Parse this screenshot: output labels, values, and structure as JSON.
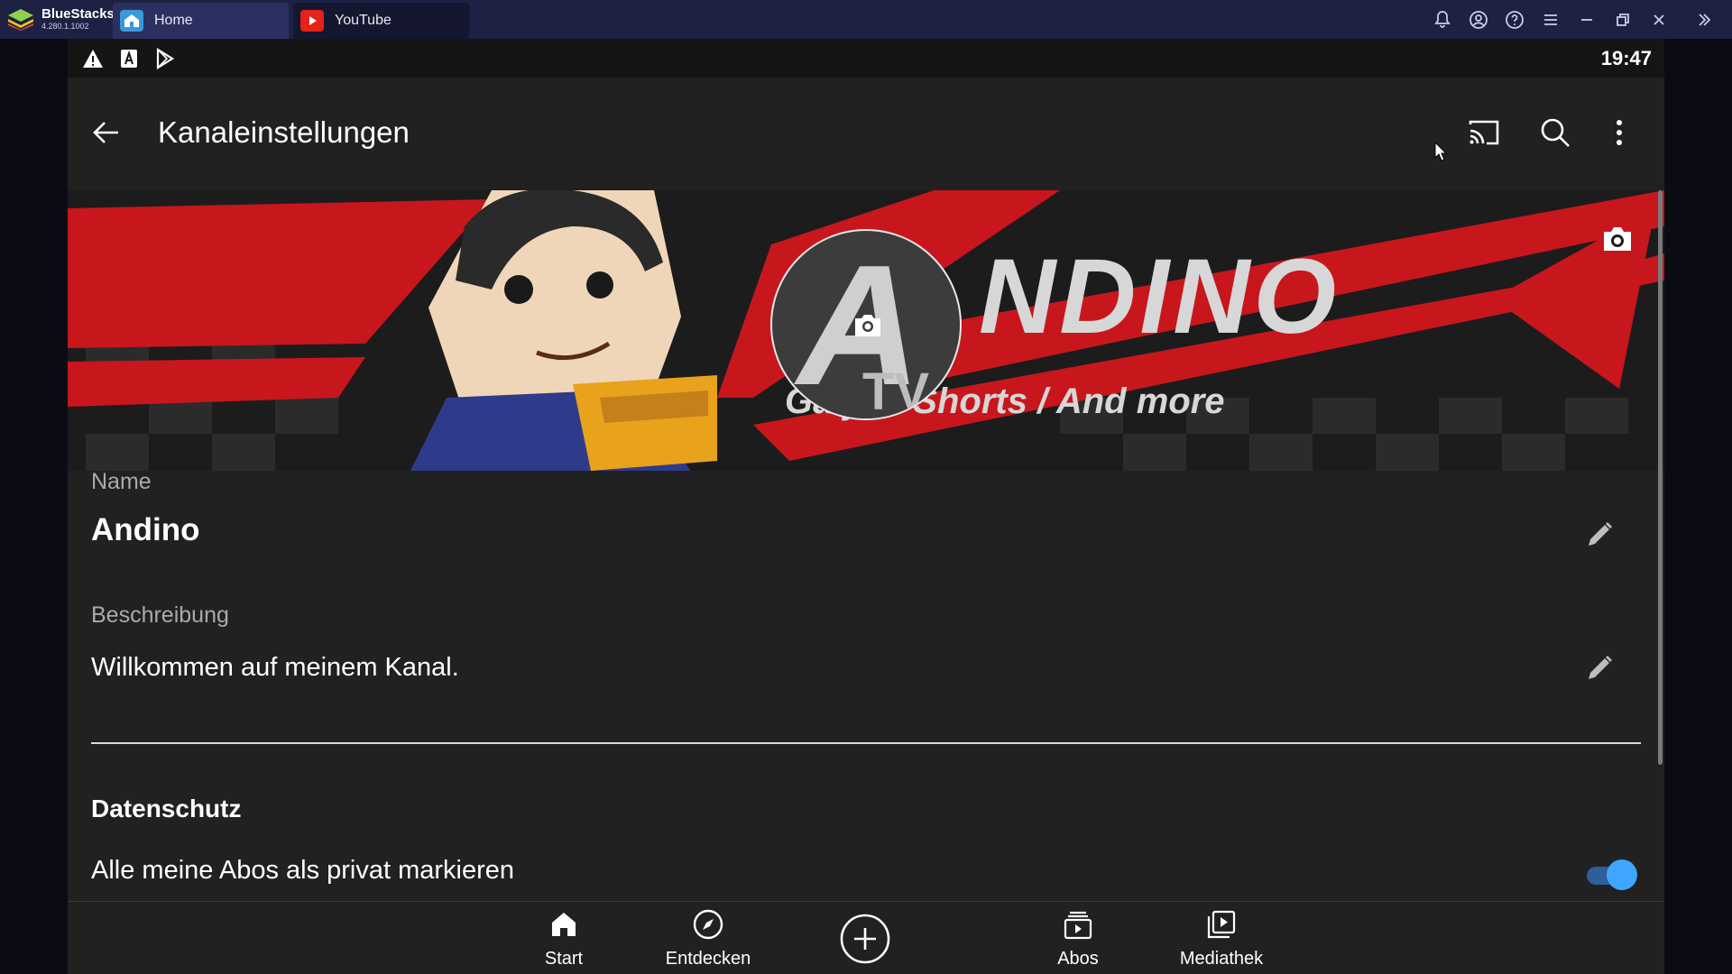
{
  "window": {
    "app_name": "BlueStacks",
    "version": "4.280.1.1002",
    "tabs": [
      {
        "label": "Home",
        "icon": "home-tab-icon",
        "color": "#3a9ad9"
      },
      {
        "label": "YouTube",
        "icon": "youtube-tab-icon",
        "color": "#e62117"
      }
    ],
    "controls": [
      "bell-icon",
      "account-icon",
      "help-icon",
      "menu-icon",
      "minimize-icon",
      "restore-icon",
      "close-icon",
      "expand-sidebar-icon"
    ]
  },
  "status_bar": {
    "time": "19:47",
    "icons": [
      "warning-icon",
      "font-icon",
      "play-store-icon"
    ]
  },
  "app_bar": {
    "title": "Kanaleinstellungen",
    "actions": [
      "cast-icon",
      "search-icon",
      "more-vert-icon"
    ]
  },
  "banner": {
    "title": "NDINO",
    "subtitle": "Ga    ys / Shorts / And more",
    "avatar_letter": "A",
    "avatar_sub": "TV"
  },
  "form": {
    "name_label": "Name",
    "name_value": "Andino",
    "description_label": "Beschreibung",
    "description_value": "Willkommen auf meinem Kanal.",
    "privacy_heading": "Datenschutz",
    "private_subs_label": "Alle meine Abos als privat markieren",
    "private_subs_enabled": true
  },
  "bottom_nav": {
    "items": [
      {
        "label": "Start",
        "icon": "home-icon"
      },
      {
        "label": "Entdecken",
        "icon": "explore-icon"
      },
      {
        "label": "",
        "icon": "add-icon"
      },
      {
        "label": "Abos",
        "icon": "subscriptions-icon"
      },
      {
        "label": "Mediathek",
        "icon": "library-icon"
      }
    ]
  },
  "colors": {
    "accent": "#3ea6ff",
    "background": "#212121",
    "titlebar": "#1d2244",
    "banner_red": "#c8161d"
  }
}
